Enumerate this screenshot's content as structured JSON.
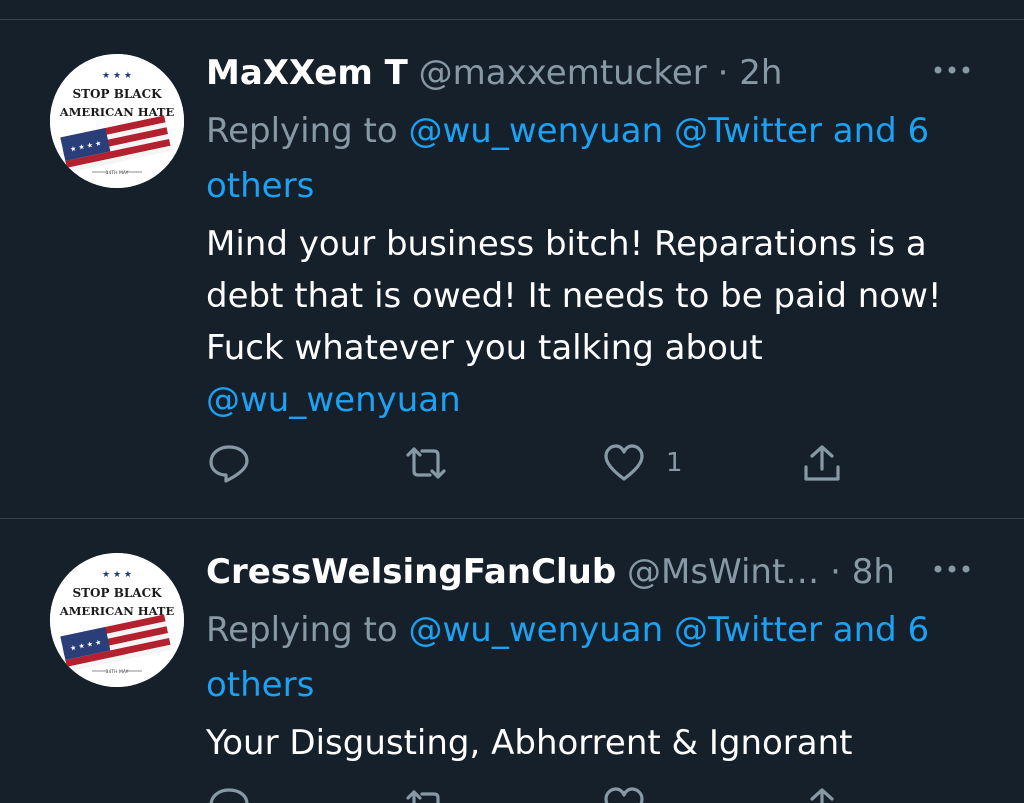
{
  "tweets": [
    {
      "display_name": "MaXXem T",
      "handle": "@maxxemtucker",
      "separator": "·",
      "time": "2h",
      "replying_prefix": "Replying to",
      "replying_mentions": "@wu_wenyuan @Twitter and 6 others",
      "body_text": "Mind your business bitch! Reparations is a debt that is owed! It needs to be paid now! Fuck whatever you talking about",
      "body_mention": "@wu_wenyuan",
      "like_count": "1",
      "avatar_text_line1": "STOP BLACK",
      "avatar_text_line2": "AMERICAN HATE",
      "avatar_text_line3": "14TH MAY"
    },
    {
      "display_name": "CressWelsingFanClub",
      "handle": "@MsWint…",
      "separator": "·",
      "time": "8h",
      "replying_prefix": "Replying to",
      "replying_mentions": "@wu_wenyuan @Twitter and 6 others",
      "body_text": "Your Disgusting, Abhorrent & Ignorant",
      "body_mention": "",
      "like_count": "",
      "avatar_text_line1": "STOP BLACK",
      "avatar_text_line2": "AMERICAN HATE",
      "avatar_text_line3": "14TH MAY"
    }
  ],
  "icons": {
    "reply": "reply-icon",
    "retweet": "retweet-icon",
    "like": "heart-icon",
    "share": "share-icon",
    "more": "more-icon"
  },
  "colors": {
    "background": "#15202b",
    "text_primary": "#ffffff",
    "text_secondary": "#8899a6",
    "link": "#1da1f2",
    "divider": "#38444d"
  }
}
